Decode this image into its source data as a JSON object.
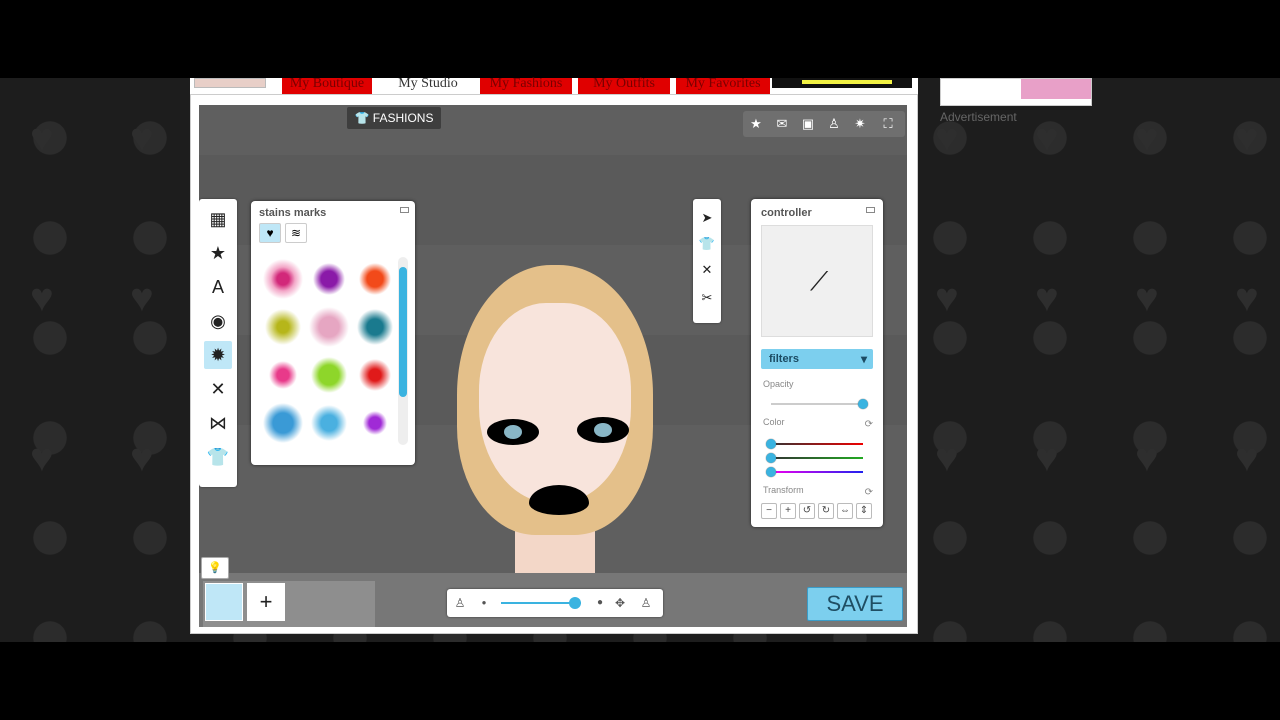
{
  "nav": {
    "tabs": [
      {
        "label": "My Boutique"
      },
      {
        "label": "My Studio"
      },
      {
        "label": "My Fashions"
      },
      {
        "label": "My Outfits"
      },
      {
        "label": "My Favorites"
      }
    ]
  },
  "ad": {
    "label": "Advertisement"
  },
  "studio": {
    "fashions_tab": "FASHIONS",
    "top_toolbar_icons": [
      "star-icon",
      "mail-icon",
      "image-icon",
      "figure-icon",
      "settings-icon",
      "fullscreen-icon"
    ],
    "left_tools": [
      "pattern-icon",
      "star-icon",
      "text-icon",
      "button-icon",
      "stain-icon",
      "sparkle-icon",
      "bow-icon",
      "shirt-icon"
    ],
    "stains_panel": {
      "title": "stains marks",
      "items": [
        "pink-splatter",
        "purple-drip",
        "orange-splatter",
        "yellow-splatter",
        "pink-spray",
        "teal-splatter",
        "pink-drip",
        "green-drip",
        "red-streak",
        "blue-splatter",
        "blue-spray",
        "purple-drop"
      ]
    },
    "right_tools": [
      "cursor-icon",
      "shirt-icon",
      "close-icon",
      "scissors-icon"
    ],
    "controller": {
      "title": "controller",
      "filters_label": "filters",
      "opacity_label": "Opacity",
      "opacity_value": 1.0,
      "color_label": "Color",
      "color_sliders": [
        0.0,
        0.0,
        0.0
      ],
      "transform_label": "Transform",
      "transform_buttons": [
        "−",
        "+",
        "↺",
        "↻",
        "⇔",
        "⇕"
      ]
    },
    "save_label": "SAVE",
    "add_label": "+",
    "zoom_value": 0.92
  }
}
